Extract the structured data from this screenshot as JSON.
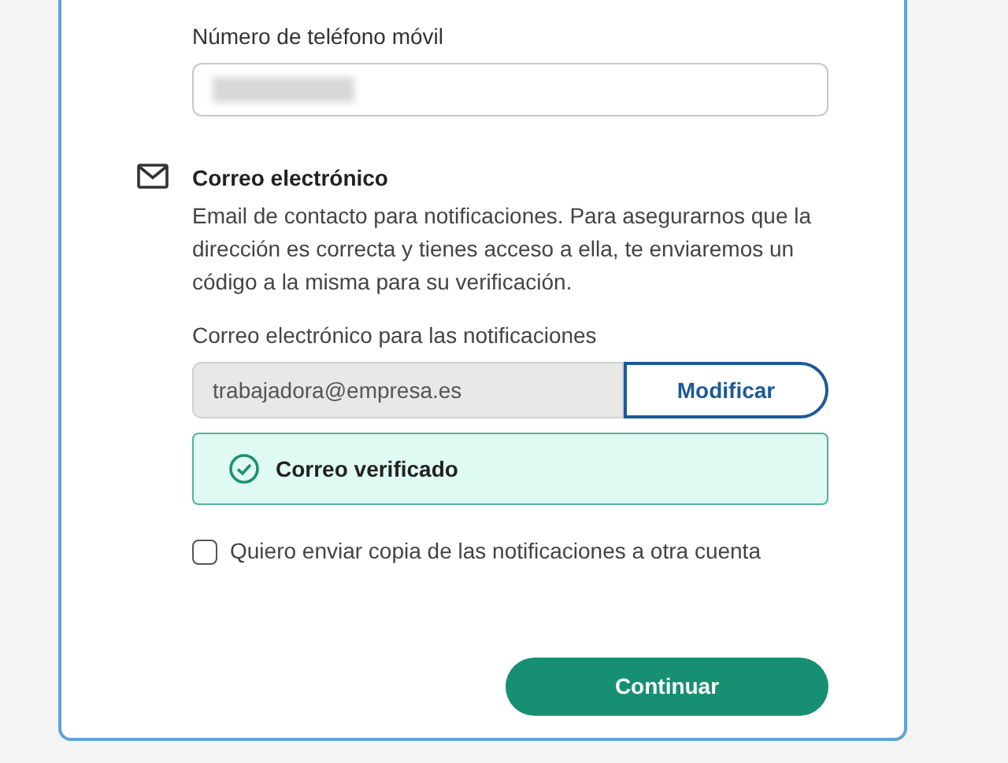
{
  "phone": {
    "label": "Número de teléfono móvil",
    "redacted": true
  },
  "email_section": {
    "title": "Correo electrónico",
    "description": "Email de contacto para notificaciones. Para asegurarnos que la dirección es correcta y tienes acceso a ella, te enviaremos un código a la misma para su verificación.",
    "field_label": "Correo electrónico para las notificaciones",
    "value": "trabajadora@empresa.es",
    "modify_button": "Modificar",
    "status": {
      "verified": true,
      "text": "Correo verificado"
    },
    "copy_checkbox": {
      "label": "Quiero enviar copia de las notificaciones a otra cuenta",
      "checked": false
    }
  },
  "continue_button": "Continuar"
}
